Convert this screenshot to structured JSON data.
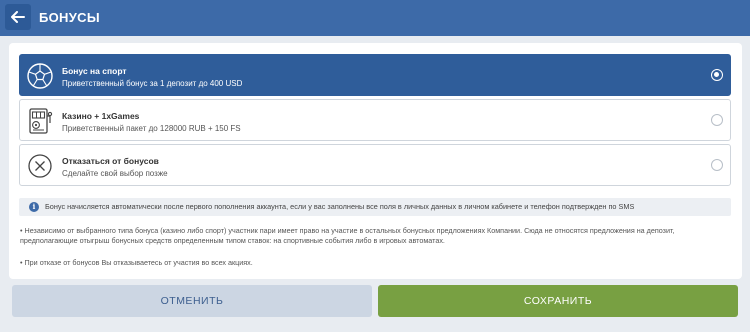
{
  "header": {
    "title": "БОНУСЫ",
    "back_icon": "arrow-left-icon",
    "color": "#3d6aa8"
  },
  "options": [
    {
      "icon": "soccer-ball-icon",
      "title": "Бонус на спорт",
      "subtitle": "Приветственный бонус за 1 депозит до 400 USD",
      "selected": true
    },
    {
      "icon": "casino-slot-icon",
      "title": "Казино + 1xGames",
      "subtitle": "Приветственный пакет до 128000 RUB + 150 FS",
      "selected": false
    },
    {
      "icon": "cross-circle-icon",
      "title": "Отказаться от бонусов",
      "subtitle": "Сделайте свой выбор позже",
      "selected": false
    }
  ],
  "info": {
    "icon": "info-icon",
    "text": "Бонус начисляется автоматически после первого пополнения аккаунта, если у вас заполнены все поля в личных данных в личном кабинете и телефон подтвержден по SMS"
  },
  "notes": [
    "• Независимо от выбранного типа бонуса (казино либо спорт) участник пари имеет право на участие в остальных бонусных предложениях Компании. Сюда не относятся предложения на депозит, предполагающие отыгрыш бонусных средств определенным типом ставок: на спортивные события либо в игровых автоматах.",
    "• При отказе от бонусов Вы отказываетесь от участия во всех акциях."
  ],
  "buttons": {
    "cancel": "ОТМЕНИТЬ",
    "save": "СОХРАНИТЬ"
  },
  "colors": {
    "selected": "#2f5d9a",
    "save": "#78a042",
    "cancel": "#ccd6e3"
  }
}
